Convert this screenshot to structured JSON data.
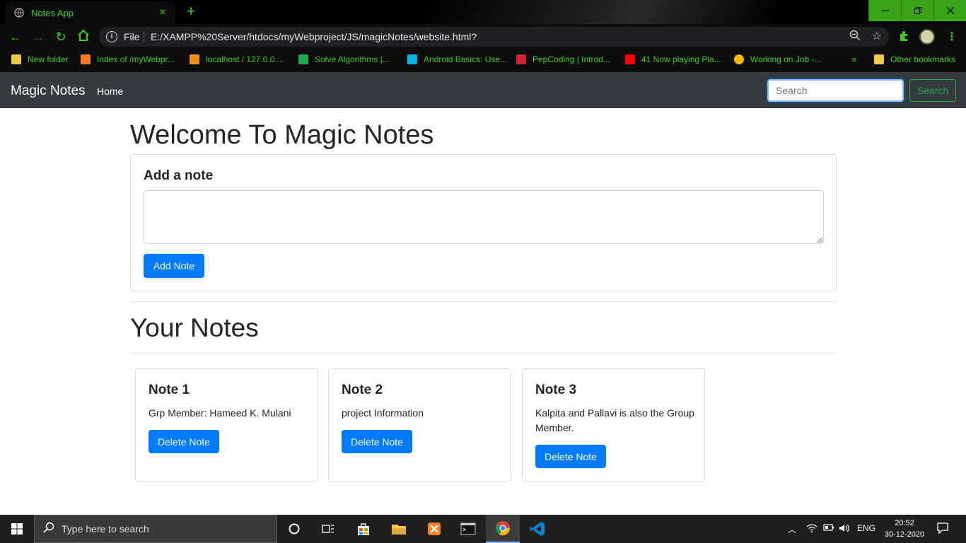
{
  "browser": {
    "tab_title": "Notes App",
    "tab_close": "×",
    "new_tab": "+",
    "address_scheme": "File",
    "address_url": "E:/XAMPP%20Server/htdocs/myWebproject/JS/magicNotes/website.html?",
    "bookmarks": [
      {
        "label": "New folder",
        "color": "#f2c94c"
      },
      {
        "label": "Index of /myWebpr...",
        "color": "#fb7a24"
      },
      {
        "label": "localhost / 127.0.0....",
        "color": "#f29111"
      },
      {
        "label": "Solve Algorithms |...",
        "color": "#1ba94c"
      },
      {
        "label": "Android Basics: Use...",
        "color": "#02b3e4"
      },
      {
        "label": "PepCoding | Introd...",
        "color": "#d1202e"
      },
      {
        "label": "41 Now playing Pla...",
        "color": "#ff0000"
      },
      {
        "label": "Working on Job -...",
        "color": "#f5b800"
      }
    ],
    "bookmarks_more": "»",
    "other_bookmarks": "Other bookmarks"
  },
  "navbar": {
    "brand": "Magic Notes",
    "home_link": "Home",
    "search_placeholder": "Search",
    "search_button": "Search"
  },
  "main": {
    "title": "Welcome To Magic Notes",
    "add_card_title": "Add a note",
    "textarea_value": "",
    "add_button": "Add Note",
    "notes_heading": "Your Notes",
    "notes": [
      {
        "title": "Note 1",
        "text": "Grp Member: Hameed K. Mulani",
        "button": "Delete Note"
      },
      {
        "title": "Note 2",
        "text": "project Information",
        "button": "Delete Note"
      },
      {
        "title": "Note 3",
        "text": "Kalpita and Pallavi is also the Group Member.",
        "button": "Delete Note"
      }
    ]
  },
  "taskbar": {
    "search_text": "Type here to search",
    "language": "ENG",
    "time": "20:52",
    "date": "30-12-2020"
  },
  "colors": {
    "accent_green": "#3ecf1a",
    "primary_blue": "#007bff",
    "navbar_bg": "#343a40",
    "success_green": "#28a745"
  }
}
